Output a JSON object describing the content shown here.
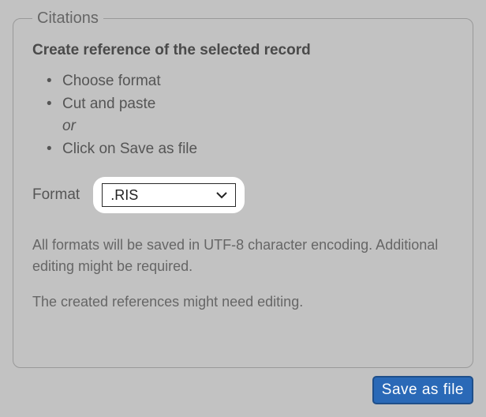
{
  "panel": {
    "legend": "Citations",
    "heading": "Create reference of the selected record",
    "steps": {
      "item0": "Choose format",
      "item1": "Cut and paste",
      "or": "or",
      "item2": "Click on Save as file"
    },
    "format_label": "Format",
    "format_value": ".RIS",
    "note1": "All formats will be saved in UTF-8 character encoding. Additional editing might be required.",
    "note2": "The created references might need editing."
  },
  "actions": {
    "save_label": "Save as file"
  }
}
